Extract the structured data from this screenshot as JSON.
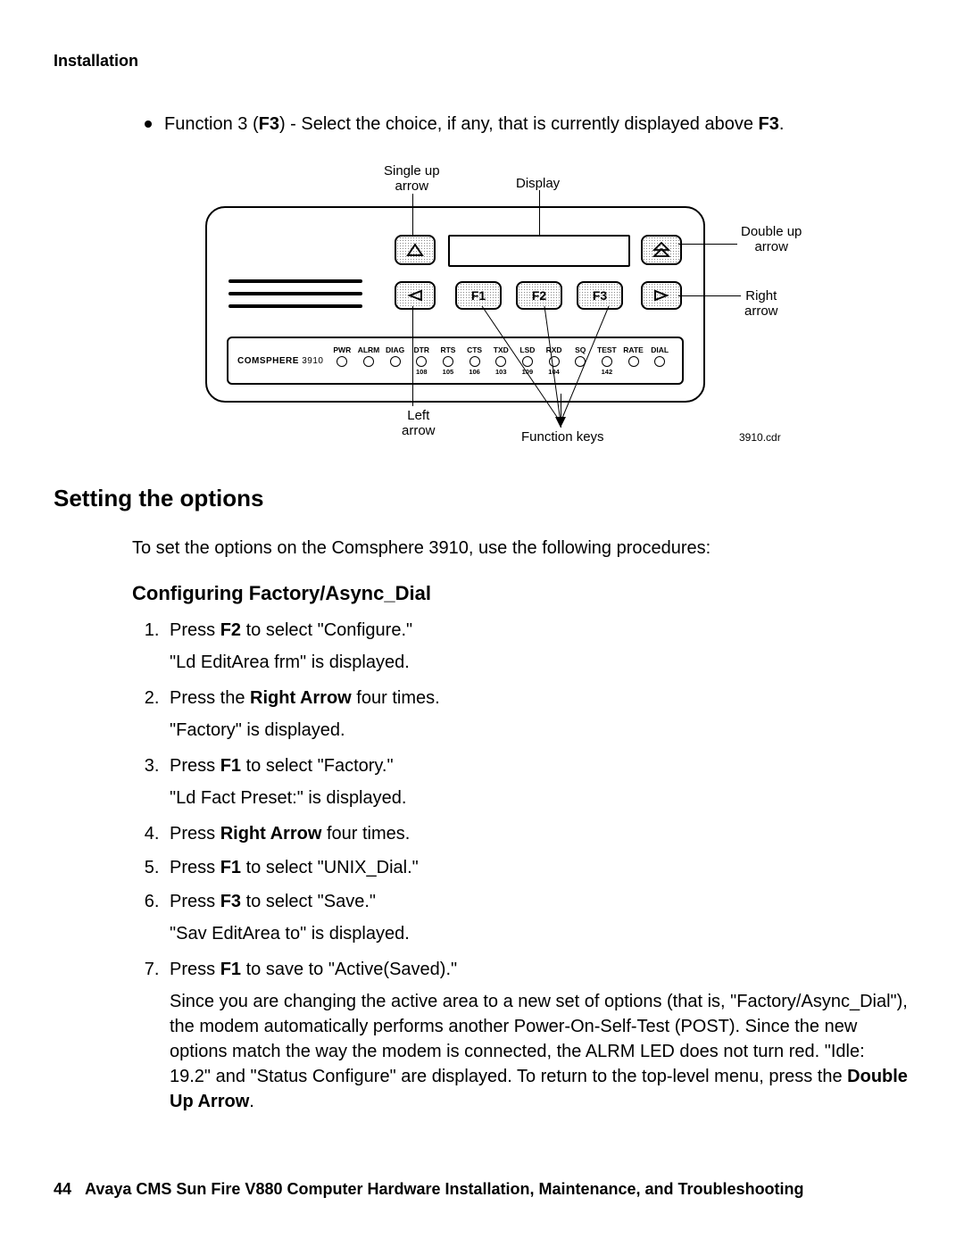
{
  "header": "Installation",
  "bullet": {
    "pre": "Function 3 (",
    "bold1": "F3",
    "mid": ") - Select the choice, if any, that is currently displayed above ",
    "bold2": "F3",
    "post": "."
  },
  "diagram": {
    "callout_single_up": "Single up\narrow",
    "callout_display": "Display",
    "callout_double_up": "Double up\narrow",
    "callout_right": "Right\narrow",
    "callout_left": "Left\narrow",
    "callout_fkeys": "Function keys",
    "f1": "F1",
    "f2": "F2",
    "f3": "F3",
    "model_bold": "COMSPHERE",
    "model_num": "3910",
    "leds": [
      {
        "top": "PWR",
        "sub": ""
      },
      {
        "top": "ALRM",
        "sub": ""
      },
      {
        "top": "DIAG",
        "sub": ""
      },
      {
        "top": "DTR",
        "sub": "108"
      },
      {
        "top": "RTS",
        "sub": "105"
      },
      {
        "top": "CTS",
        "sub": "106"
      },
      {
        "top": "TXD",
        "sub": "103"
      },
      {
        "top": "LSD",
        "sub": "109"
      },
      {
        "top": "RXD",
        "sub": "104"
      },
      {
        "top": "SQ",
        "sub": ""
      },
      {
        "top": "TEST",
        "sub": "142"
      },
      {
        "top": "RATE",
        "sub": ""
      },
      {
        "top": "DIAL",
        "sub": ""
      }
    ],
    "filename": "3910.cdr"
  },
  "h2": "Setting the options",
  "para1": "To set the options on the Comsphere 3910, use the following procedures:",
  "h3": "Configuring Factory/Async_Dial",
  "steps": {
    "s1a": "Press ",
    "s1b": "F2",
    "s1c": " to select \"Configure.\"",
    "s1sub": "\"Ld EditArea frm\" is displayed.",
    "s2a": "Press the ",
    "s2b": "Right Arrow",
    "s2c": " four times.",
    "s2sub": "\"Factory\" is displayed.",
    "s3a": "Press ",
    "s3b": "F1",
    "s3c": " to select \"Factory.\"",
    "s3sub": "\"Ld Fact Preset:\" is displayed.",
    "s4a": "Press ",
    "s4b": "Right Arrow",
    "s4c": " four times.",
    "s5a": "Press ",
    "s5b": "F1",
    "s5c": " to select \"UNIX_Dial.\"",
    "s6a": "Press ",
    "s6b": "F3",
    "s6c": " to select \"Save.\"",
    "s6sub": "\"Sav EditArea to\" is displayed.",
    "s7a": "Press ",
    "s7b": "F1",
    "s7c": " to save to \"Active(Saved).\"",
    "s7p_a": "Since you are changing the active area to a new set of options (that is, \"Factory/Async_Dial\"), the modem automatically performs another Power-On-Self-Test (POST). Since the new options match the way the modem is connected, the ALRM LED does not turn red. \"Idle: 19.2\" and \"Status Configure\" are displayed. To return to the top-level menu, press the ",
    "s7p_b": "Double Up Arrow",
    "s7p_c": "."
  },
  "footer_page": "44",
  "footer_title": "Avaya CMS Sun Fire V880 Computer Hardware Installation, Maintenance, and Troubleshooting"
}
